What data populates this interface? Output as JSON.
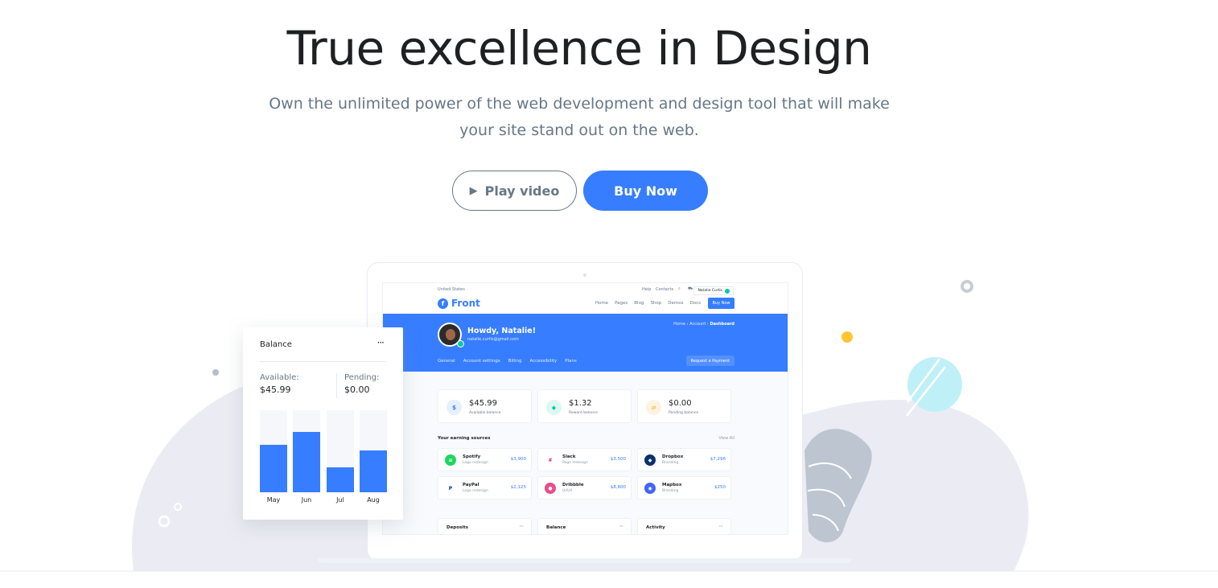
{
  "hero": {
    "title": "True excellence in Design",
    "subtitle": "Own the unlimited power of the web development and design tool that will make your site stand out on the web.",
    "play_label": "Play video",
    "buy_label": "Buy Now"
  },
  "mockup": {
    "topbar": {
      "region": "United States",
      "help": "Help",
      "contacts": "Contacts",
      "user": "Natalie Curtis",
      "brand": "Front",
      "nav": [
        "Home",
        "Pages",
        "Blog",
        "Shop",
        "Demos",
        "Docs"
      ],
      "buy": "Buy Now"
    },
    "banner": {
      "greeting": "Howdy, Natalie!",
      "email": "natalie.curtis@gmail.com",
      "crumb_home": "Home",
      "crumb_account": "Account",
      "crumb_current": "Dashboard",
      "tabs": [
        "General",
        "Account settings",
        "Billing",
        "Accessibility",
        "Plans"
      ],
      "request": "Request a Payment"
    },
    "stats": [
      {
        "value": "$45.99",
        "label": "Available balance",
        "symbol": "$",
        "color": "#377dff"
      },
      {
        "value": "$1.32",
        "label": "Reward balance",
        "symbol": "◆",
        "color": "#00c9a7"
      },
      {
        "value": "$0.00",
        "label": "Pending balance",
        "symbol": "⇄",
        "color": "#f5ca99"
      }
    ],
    "earnings_title": "Your earning sources",
    "view_all": "View All",
    "sources": [
      {
        "name": "Spotify",
        "sub": "Logo redesign",
        "amount": "$3,900",
        "color": "#1ed760",
        "glyph": "≋"
      },
      {
        "name": "Slack",
        "sub": "Page redesign",
        "amount": "$3,500",
        "color": "#4a154b",
        "glyph": "#"
      },
      {
        "name": "Dropbox",
        "sub": "Branding",
        "amount": "$7,296",
        "color": "#0d2f6e",
        "glyph": "◆"
      },
      {
        "name": "PayPal",
        "sub": "Logo redesign",
        "amount": "$2,125",
        "color": "#003087",
        "glyph": "P"
      },
      {
        "name": "Dribbble",
        "sub": "UI/UX",
        "amount": "$8,800",
        "color": "#ea4c89",
        "glyph": "●"
      },
      {
        "name": "Mapbox",
        "sub": "Branding",
        "amount": "$250",
        "color": "#4264fb",
        "glyph": "◉"
      }
    ],
    "bottom_cards": [
      "Deposits",
      "Balance",
      "Activity"
    ],
    "more": "···"
  },
  "balance_card": {
    "title": "Balance",
    "more": "···",
    "available_label": "Available:",
    "available_value": "$45.99",
    "pending_label": "Pending:",
    "pending_value": "$0.00",
    "bars": [
      {
        "label": "May",
        "level": 0.58
      },
      {
        "label": "Jun",
        "level": 0.74
      },
      {
        "label": "Jul",
        "level": 0.3
      },
      {
        "label": "Aug",
        "level": 0.51
      }
    ],
    "accent": "#377dff"
  },
  "colors": {
    "primary": "#377dff",
    "muted": "#677788"
  }
}
